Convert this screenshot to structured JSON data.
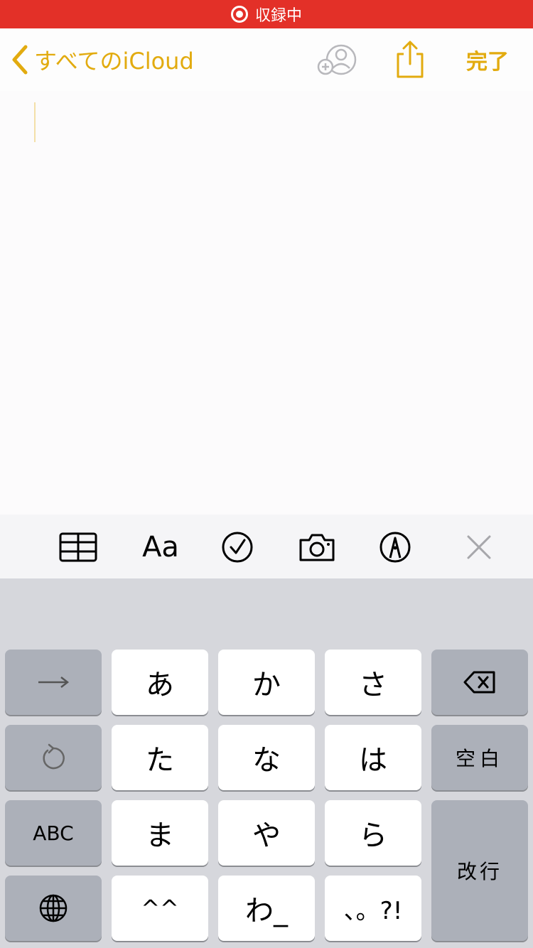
{
  "status_bar": {
    "recording_label": "収録中"
  },
  "nav": {
    "back_label": "すべてのiCloud",
    "done_label": "完了",
    "accent_color": "#e2ab0f",
    "icons": [
      "chevron-left-icon",
      "add-person-icon",
      "share-icon"
    ]
  },
  "note": {
    "body_text": ""
  },
  "toolbar": {
    "format_label": "Aa",
    "icons": [
      "table-icon",
      "format-icon",
      "checklist-icon",
      "camera-icon",
      "markup-icon",
      "close-icon"
    ]
  },
  "keyboard": {
    "row1": {
      "k1": "あ",
      "k2": "か",
      "k3": "さ"
    },
    "row2": {
      "k1": "た",
      "k2": "な",
      "k3": "は",
      "space": "空白"
    },
    "row3": {
      "abc": "ABC",
      "k1": "ま",
      "k2": "や",
      "k3": "ら",
      "return": "改行"
    },
    "row4": {
      "k1": "^^",
      "k2": "わ_",
      "k3": "、。?!"
    },
    "icons": [
      "arrow-right-icon",
      "delete-icon",
      "undo-icon",
      "globe-icon"
    ]
  }
}
